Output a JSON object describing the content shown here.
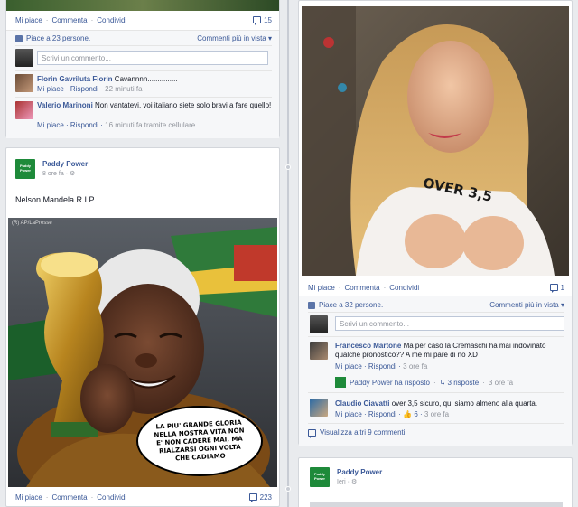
{
  "left_post_top": {
    "actions": {
      "like": "Mi piace",
      "comment": "Commenta",
      "share": "Condividi"
    },
    "comment_count": "15",
    "likes_text": "Piace a 23 persone.",
    "view_option": "Commenti più in vista",
    "comment_placeholder": "Scrivi un commento...",
    "comments": [
      {
        "name": "Florin Gavriluta Florin",
        "text": "Cavannnn...............",
        "like": "Mi piace",
        "reply": "Rispondi",
        "time": "22 minuti fa"
      },
      {
        "name": "Valerio Marinoni",
        "text": "Non vantatevi, voi italiano siete solo bravi a fare quello!",
        "like": "Mi piace",
        "reply": "Rispondi",
        "time": "16 minuti fa tramite cellulare"
      }
    ]
  },
  "left_post_bottom": {
    "page_name": "Paddy Power",
    "logo_text": "Paddy Power",
    "time": "8 ore fa",
    "text": "Nelson Mandela R.I.P.",
    "credit": "(R) AP/LaPresse",
    "speech": "LA PIU' GRANDE GLORIA NELLA NOSTRA VITA NON E' NON CADERE MAI, MA RIALZARSI OGNI VOLTA CHE CADIAMO",
    "actions": {
      "like": "Mi piace",
      "comment": "Commenta",
      "share": "Condividi"
    },
    "comment_count": "223"
  },
  "right_post_top": {
    "shirt_text": "OVER 3,5",
    "actions": {
      "like": "Mi piace",
      "comment": "Commenta",
      "share": "Condividi"
    },
    "comment_count": "1",
    "likes_text": "Piace a 32 persone.",
    "view_option": "Commenti più in vista",
    "comment_placeholder": "Scrivi un commento...",
    "comments": [
      {
        "name": "Francesco Martone",
        "text": "Ma per caso la Cremaschi ha mai indovinato qualche pronostico?? A me mi pare di no XD",
        "like": "Mi piace",
        "reply": "Rispondi",
        "time": "3 ore fa"
      },
      {
        "name": "Claudio Ciavatti",
        "text": "over 3,5 sicuro, qui siamo almeno alla quarta.",
        "like": "Mi piace",
        "reply": "Rispondi",
        "likes": "6",
        "time": "3 ore fa"
      }
    ],
    "reply_summary": {
      "page": "Paddy Power ha risposto",
      "count": "3 risposte",
      "time": "3 ore fa"
    },
    "view_more": "Visualizza altri 9 commenti"
  },
  "right_post_bottom": {
    "page_name": "Paddy Power",
    "logo_text": "Paddy Power",
    "time": "Ieri"
  },
  "colors": {
    "link": "#3b5998",
    "brand_green": "#1e8a3a",
    "background": "#e9ebee"
  }
}
